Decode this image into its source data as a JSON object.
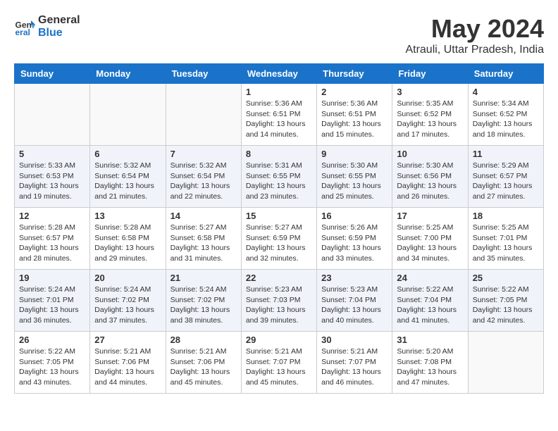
{
  "logo": {
    "line1": "General",
    "line2": "Blue"
  },
  "title": "May 2024",
  "location": "Atrauli, Uttar Pradesh, India",
  "weekdays": [
    "Sunday",
    "Monday",
    "Tuesday",
    "Wednesday",
    "Thursday",
    "Friday",
    "Saturday"
  ],
  "weeks": [
    [
      {
        "day": "",
        "info": ""
      },
      {
        "day": "",
        "info": ""
      },
      {
        "day": "",
        "info": ""
      },
      {
        "day": "1",
        "info": "Sunrise: 5:36 AM\nSunset: 6:51 PM\nDaylight: 13 hours\nand 14 minutes."
      },
      {
        "day": "2",
        "info": "Sunrise: 5:36 AM\nSunset: 6:51 PM\nDaylight: 13 hours\nand 15 minutes."
      },
      {
        "day": "3",
        "info": "Sunrise: 5:35 AM\nSunset: 6:52 PM\nDaylight: 13 hours\nand 17 minutes."
      },
      {
        "day": "4",
        "info": "Sunrise: 5:34 AM\nSunset: 6:52 PM\nDaylight: 13 hours\nand 18 minutes."
      }
    ],
    [
      {
        "day": "5",
        "info": "Sunrise: 5:33 AM\nSunset: 6:53 PM\nDaylight: 13 hours\nand 19 minutes."
      },
      {
        "day": "6",
        "info": "Sunrise: 5:32 AM\nSunset: 6:54 PM\nDaylight: 13 hours\nand 21 minutes."
      },
      {
        "day": "7",
        "info": "Sunrise: 5:32 AM\nSunset: 6:54 PM\nDaylight: 13 hours\nand 22 minutes."
      },
      {
        "day": "8",
        "info": "Sunrise: 5:31 AM\nSunset: 6:55 PM\nDaylight: 13 hours\nand 23 minutes."
      },
      {
        "day": "9",
        "info": "Sunrise: 5:30 AM\nSunset: 6:55 PM\nDaylight: 13 hours\nand 25 minutes."
      },
      {
        "day": "10",
        "info": "Sunrise: 5:30 AM\nSunset: 6:56 PM\nDaylight: 13 hours\nand 26 minutes."
      },
      {
        "day": "11",
        "info": "Sunrise: 5:29 AM\nSunset: 6:57 PM\nDaylight: 13 hours\nand 27 minutes."
      }
    ],
    [
      {
        "day": "12",
        "info": "Sunrise: 5:28 AM\nSunset: 6:57 PM\nDaylight: 13 hours\nand 28 minutes."
      },
      {
        "day": "13",
        "info": "Sunrise: 5:28 AM\nSunset: 6:58 PM\nDaylight: 13 hours\nand 29 minutes."
      },
      {
        "day": "14",
        "info": "Sunrise: 5:27 AM\nSunset: 6:58 PM\nDaylight: 13 hours\nand 31 minutes."
      },
      {
        "day": "15",
        "info": "Sunrise: 5:27 AM\nSunset: 6:59 PM\nDaylight: 13 hours\nand 32 minutes."
      },
      {
        "day": "16",
        "info": "Sunrise: 5:26 AM\nSunset: 6:59 PM\nDaylight: 13 hours\nand 33 minutes."
      },
      {
        "day": "17",
        "info": "Sunrise: 5:25 AM\nSunset: 7:00 PM\nDaylight: 13 hours\nand 34 minutes."
      },
      {
        "day": "18",
        "info": "Sunrise: 5:25 AM\nSunset: 7:01 PM\nDaylight: 13 hours\nand 35 minutes."
      }
    ],
    [
      {
        "day": "19",
        "info": "Sunrise: 5:24 AM\nSunset: 7:01 PM\nDaylight: 13 hours\nand 36 minutes."
      },
      {
        "day": "20",
        "info": "Sunrise: 5:24 AM\nSunset: 7:02 PM\nDaylight: 13 hours\nand 37 minutes."
      },
      {
        "day": "21",
        "info": "Sunrise: 5:24 AM\nSunset: 7:02 PM\nDaylight: 13 hours\nand 38 minutes."
      },
      {
        "day": "22",
        "info": "Sunrise: 5:23 AM\nSunset: 7:03 PM\nDaylight: 13 hours\nand 39 minutes."
      },
      {
        "day": "23",
        "info": "Sunrise: 5:23 AM\nSunset: 7:04 PM\nDaylight: 13 hours\nand 40 minutes."
      },
      {
        "day": "24",
        "info": "Sunrise: 5:22 AM\nSunset: 7:04 PM\nDaylight: 13 hours\nand 41 minutes."
      },
      {
        "day": "25",
        "info": "Sunrise: 5:22 AM\nSunset: 7:05 PM\nDaylight: 13 hours\nand 42 minutes."
      }
    ],
    [
      {
        "day": "26",
        "info": "Sunrise: 5:22 AM\nSunset: 7:05 PM\nDaylight: 13 hours\nand 43 minutes."
      },
      {
        "day": "27",
        "info": "Sunrise: 5:21 AM\nSunset: 7:06 PM\nDaylight: 13 hours\nand 44 minutes."
      },
      {
        "day": "28",
        "info": "Sunrise: 5:21 AM\nSunset: 7:06 PM\nDaylight: 13 hours\nand 45 minutes."
      },
      {
        "day": "29",
        "info": "Sunrise: 5:21 AM\nSunset: 7:07 PM\nDaylight: 13 hours\nand 45 minutes."
      },
      {
        "day": "30",
        "info": "Sunrise: 5:21 AM\nSunset: 7:07 PM\nDaylight: 13 hours\nand 46 minutes."
      },
      {
        "day": "31",
        "info": "Sunrise: 5:20 AM\nSunset: 7:08 PM\nDaylight: 13 hours\nand 47 minutes."
      },
      {
        "day": "",
        "info": ""
      }
    ]
  ]
}
